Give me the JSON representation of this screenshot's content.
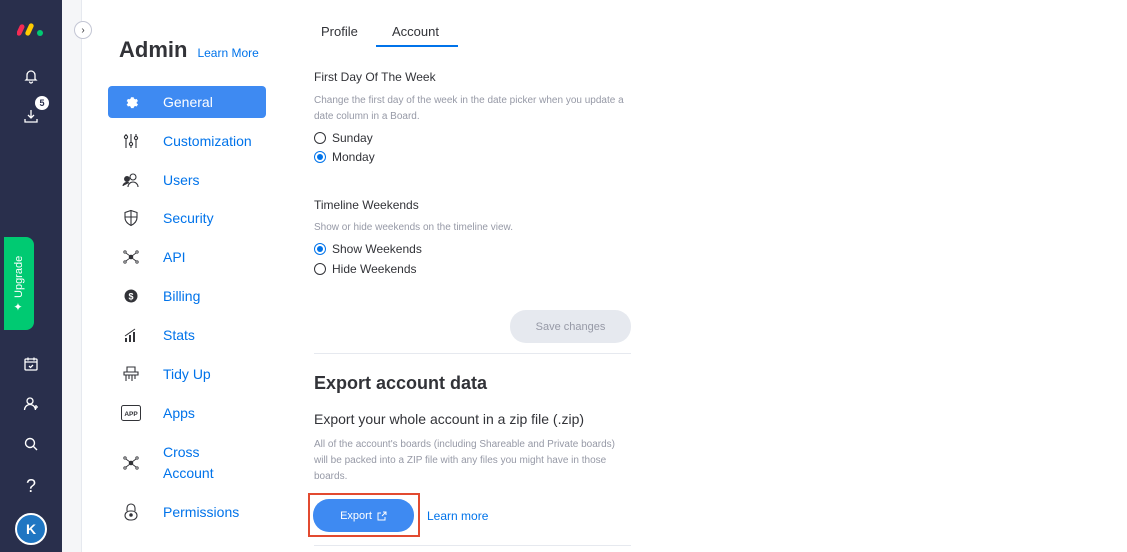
{
  "sidebar": {
    "badge_count": "5",
    "upgrade_label": "Upgrade",
    "avatar_initial": "K"
  },
  "admin": {
    "title": "Admin",
    "learn_more": "Learn More",
    "nav": [
      {
        "label": "General",
        "icon": "gear-icon",
        "active": true
      },
      {
        "label": "Customization",
        "icon": "sliders-icon"
      },
      {
        "label": "Users",
        "icon": "users-icon"
      },
      {
        "label": "Security",
        "icon": "shield-icon"
      },
      {
        "label": "API",
        "icon": "network-icon"
      },
      {
        "label": "Billing",
        "icon": "dollar-icon"
      },
      {
        "label": "Stats",
        "icon": "stats-icon"
      },
      {
        "label": "Tidy Up",
        "icon": "shredder-icon"
      },
      {
        "label": "Apps",
        "icon": "app-icon"
      },
      {
        "label": "Cross Account",
        "icon": "cross-account-icon"
      },
      {
        "label": "Permissions",
        "icon": "lock-icon"
      }
    ]
  },
  "tabs": {
    "profile": "Profile",
    "account": "Account"
  },
  "week": {
    "title": "First Day Of The Week",
    "desc": "Change the first day of the week in the date picker when you update a date column in a Board.",
    "options": [
      "Sunday",
      "Monday"
    ],
    "selected": "Monday"
  },
  "timeline": {
    "title": "Timeline Weekends",
    "desc": "Show or hide weekends on the timeline view.",
    "options": [
      "Show Weekends",
      "Hide Weekends"
    ],
    "selected": "Show Weekends"
  },
  "save_label": "Save changes",
  "export": {
    "title": "Export account data",
    "subtitle": "Export your whole account in a zip file (.zip)",
    "desc": "All of the account's boards (including Shareable and Private boards) will be packed into a ZIP file with any files you might have in those boards.",
    "button_label": "Export",
    "learn_more": "Learn more"
  },
  "colors": {
    "rail": "#292f4c",
    "primary": "#0073ea",
    "active_nav": "#3e8af2",
    "upgrade": "#00ca72",
    "highlight": "#e24a30"
  }
}
